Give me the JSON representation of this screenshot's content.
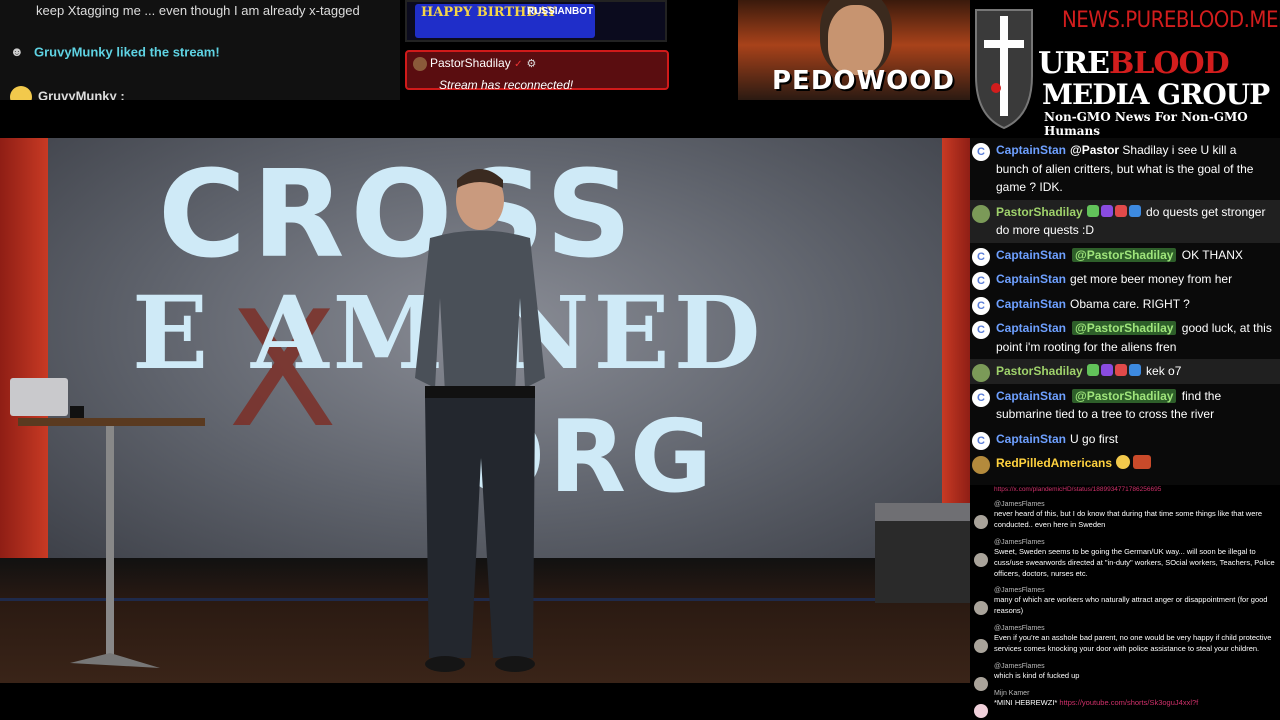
{
  "top_chat": {
    "line1": "keep Xtagging me ... even though I am already x-tagged",
    "liked_text": "GruvyMunky liked the stream!",
    "line3_user": "GruvyMunky :"
  },
  "banner": {
    "text": "HAPPY BIRTHDAY",
    "tag": "RUSSIANBOT"
  },
  "alert": {
    "user": "PastorShadilay",
    "message": "Stream has reconnected!"
  },
  "thumbnail": {
    "label": "PEDOWOOD"
  },
  "logo": {
    "site": "NEWS.PUREBLOOD.MEDIA",
    "brand_line1_a": "URE",
    "brand_line1_b": "BLOOD",
    "brand_line2": "MEDIA GROUP",
    "tagline": "Non-GMO News For Non-GMO Humans"
  },
  "video": {
    "title_line1": "CROSS",
    "title_line2": "E AMINED",
    "title_line3": ".ORG",
    "x_mark": "X"
  },
  "chat": [
    {
      "user": "CaptainStan",
      "avatar": "C",
      "prefix": "@Pastor",
      "text": "Shadilay i see U kill a bunch of alien critters, but what is the goal of the game ? IDK.",
      "highlight": false
    },
    {
      "user": "PastorShadilay",
      "avatar": "P",
      "badges": true,
      "text": "do quests get stronger do more quests :D",
      "highlight": true
    },
    {
      "user": "CaptainStan",
      "avatar": "C",
      "mention": "@PastorShadilay",
      "text": "OK THANX"
    },
    {
      "user": "CaptainStan",
      "avatar": "C",
      "text": "get more beer money from her"
    },
    {
      "user": "CaptainStan",
      "avatar": "C",
      "text": "Obama care. RIGHT ?"
    },
    {
      "user": "CaptainStan",
      "avatar": "C",
      "mention": "@PastorShadilay",
      "text": "good luck, at this point i'm rooting for the aliens fren"
    },
    {
      "user": "PastorShadilay",
      "avatar": "P",
      "badges": true,
      "text": "kek o7",
      "highlight": true
    },
    {
      "user": "CaptainStan",
      "avatar": "C",
      "mention": "@PastorShadilay",
      "text": "find the submarine tied to a tree to cross the river"
    },
    {
      "user": "CaptainStan",
      "avatar": "C",
      "text": "U go first"
    },
    {
      "user": "RedPilledAmericans",
      "avatar": "R",
      "text": ""
    }
  ],
  "chat2": {
    "link_top": "https://x.com/plandemicHD/status/1889934771786256695",
    "messages": [
      {
        "user": "@JamesFlames",
        "text": "never heard of this, but I do know that during that time some things like that were conducted.. even here in Sweden"
      },
      {
        "user": "@JamesFlames",
        "text": "Sweet, Sweden seems to be going the German/UK way... will soon be illegal to cuss/use swearwords directed at \"in-duty\" workers, SOcial workers, Teachers, Police officers, doctors, nurses etc."
      },
      {
        "user": "@JamesFlames",
        "text": "many of which are workers who naturally attract anger or disappointment (for good reasons)"
      },
      {
        "user": "@JamesFlames",
        "text": "Even if you're an asshole bad parent, no one would be very happy if child protective services comes knocking your door with police assistance to steal your children."
      },
      {
        "user": "@JamesFlames",
        "text": "which is kind of fucked up"
      },
      {
        "user": "Mijn Kamer",
        "text": "*MINI HEBREWZI*",
        "link": "https://youtube.com/shorts/Sk3oguJ4xxl?f"
      }
    ]
  }
}
